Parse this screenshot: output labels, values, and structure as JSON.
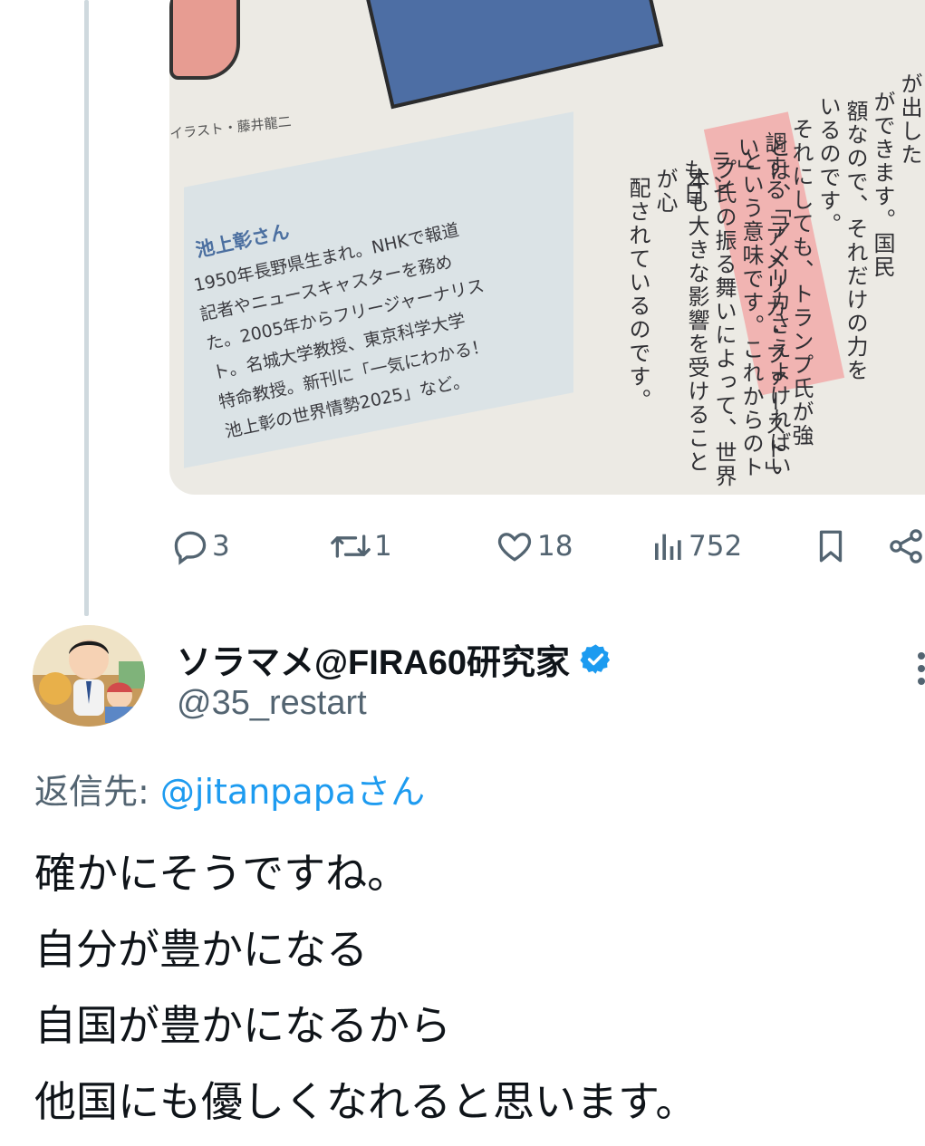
{
  "previous_tweet": {
    "image": {
      "credit": "イラスト・藤井龍二",
      "bio_name": "池上彰さん",
      "bio_lines": [
        "1950年長野県生まれ。NHKで報道",
        "記者やニュースキャスターを務め",
        "た。2005年からフリージャーナリス",
        "ト。名城大学教授、東京科学大学",
        "特命教授。新刊に「一気にわかる！",
        "池上彰の世界情勢2025」など。"
      ],
      "article_columns": [
        "が出した",
        "ができます。国民",
        "額なので、それだけの力を",
        "いるのです。",
        "それにしても、トランプ氏が強",
        "調する「アメリカ・ファースト」",
        "とは、「アメリカさえよければいい」",
        "という意味です。これからのトラン",
        "プ氏の振る舞いによって、世界も日",
        "本も大きな影響を受けることが心",
        "配されているのです。"
      ]
    },
    "actions": {
      "replies": "3",
      "retweets": "1",
      "likes": "18",
      "views": "752"
    },
    "icons": [
      "reply-icon",
      "retweet-icon",
      "like-icon",
      "views-icon",
      "bookmark-icon",
      "share-icon"
    ]
  },
  "reply": {
    "display_name": "ソラマメ@FIRA60研究家",
    "handle": "@35_restart",
    "verified": true,
    "reply_to_label": "返信先:",
    "reply_to_mention": "@jitanpapaさん",
    "body_lines": [
      "確かにそうですね。",
      "自分が豊かになる",
      "自国が豊かになるから",
      "他国にも優しくなれると思います。"
    ]
  },
  "colors": {
    "accent": "#1d9bf0",
    "muted": "#536471",
    "text": "#0f1419",
    "thread_line": "#cfd9de"
  }
}
